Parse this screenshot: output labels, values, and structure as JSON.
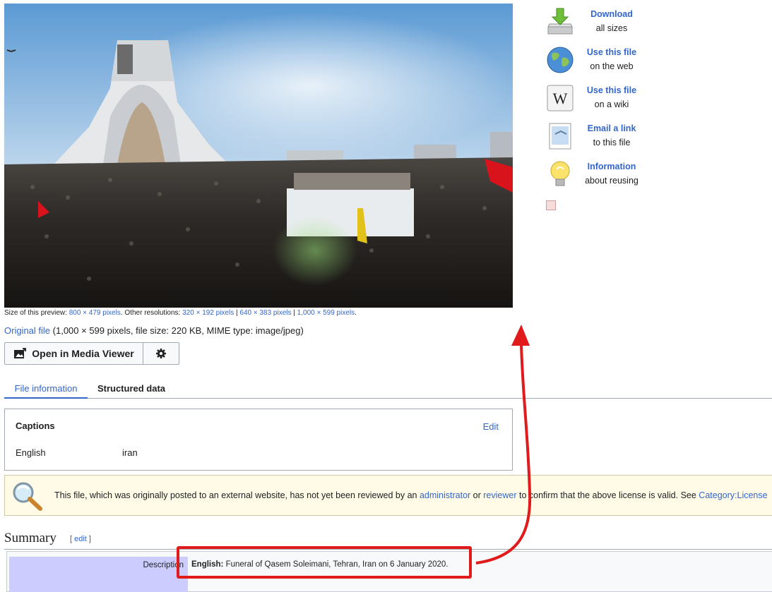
{
  "preview": {
    "prefix": "Size of this preview: ",
    "preview_size": "800 × 479 pixels",
    "other_label": ". Other resolutions: ",
    "resolutions": [
      "320 × 192 pixels",
      "640 × 383 pixels",
      "1,000 × 599 pixels"
    ],
    "separator": " | ",
    "end": "."
  },
  "original": {
    "link": "Original file",
    "info": " (1,000 × 599 pixels, file size: 220 KB, MIME type: image/jpeg)"
  },
  "media_viewer": {
    "open_label": "Open in Media Viewer"
  },
  "tabs": [
    {
      "label": "File information",
      "active": true
    },
    {
      "label": "Structured data",
      "active": false
    }
  ],
  "captions": {
    "title": "Captions",
    "edit": "Edit",
    "language": "English",
    "value": "iran"
  },
  "notice": {
    "part1": "This file, which was originally posted to an external website, has not yet been reviewed by an ",
    "admin_link": "administrator",
    "part2": " or ",
    "reviewer_link": "reviewer",
    "part3": " to confirm that the above license is valid. See ",
    "category_link": "Category:License"
  },
  "summary": {
    "title": "Summary",
    "edit_open": "[ ",
    "edit_link": "edit",
    "edit_close": " ]",
    "description_label": "Description",
    "lang_label": "English:",
    "description_text": " Funeral of Qasem Soleimani, Tehran, Iran on 6 January 2020."
  },
  "side_panel": [
    {
      "main": "Download",
      "sub": "all sizes",
      "icon": "download-icon"
    },
    {
      "main": "Use this file",
      "sub": "on the web",
      "icon": "globe-icon"
    },
    {
      "main": "Use this file",
      "sub": "on a wiki",
      "icon": "wiki-icon"
    },
    {
      "main": "Email a link",
      "sub": "to this file",
      "icon": "email-icon"
    },
    {
      "main": "Information",
      "sub": "about reusing",
      "icon": "lightbulb-icon"
    }
  ],
  "colors": {
    "link": "#3366cc",
    "annotation": "#e11b1b",
    "notice_bg": "#fffbe6",
    "description_label_bg": "#ccccff"
  }
}
